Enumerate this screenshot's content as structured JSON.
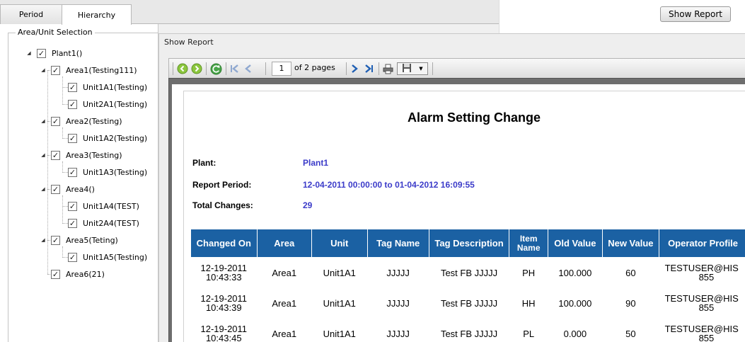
{
  "tabs": [
    {
      "label": "Period"
    },
    {
      "label": "Hierarchy"
    }
  ],
  "left": {
    "group_label": "Area/Unit Selection",
    "tree": [
      {
        "label": "Plant1()"
      },
      {
        "label": "Area1(Testing111)"
      },
      {
        "label": "Unit1A1(Testing)"
      },
      {
        "label": "Unit2A1(Testing)"
      },
      {
        "label": "Area2(Testing)"
      },
      {
        "label": "Unit1A2(Testing)"
      },
      {
        "label": "Area3(Testing)"
      },
      {
        "label": "Unit1A3(Testing)"
      },
      {
        "label": "Area4()"
      },
      {
        "label": "Unit1A4(TEST)"
      },
      {
        "label": "Unit2A4(TEST)"
      },
      {
        "label": "Area5(Teting)"
      },
      {
        "label": "Unit1A5(Testing)"
      },
      {
        "label": "Area6(21)"
      }
    ]
  },
  "right": {
    "show_report_label": "Show Report"
  },
  "window": {
    "title": "Show Report"
  },
  "toolbar": {
    "page_value": "1",
    "page_of": "of 2 pages"
  },
  "report": {
    "title": "Alarm Setting Change",
    "plant_label": "Plant:",
    "plant_value": "Plant1",
    "period_label": "Report Period:",
    "period_value": "12-04-2011 00:00:00 to 01-04-2012 16:09:55",
    "changes_label": "Total Changes:",
    "changes_value": "29",
    "columns": [
      "Changed On",
      "Area",
      "Unit",
      "Tag Name",
      "Tag Description",
      "Item Name",
      "Old Value",
      "New Value",
      "Operator Profile"
    ],
    "rows": [
      {
        "date": "12-19-2011",
        "time": "10:43:33",
        "area": "Area1",
        "unit": "Unit1A1",
        "tag": "JJJJJ",
        "desc": "Test FB JJJJJ",
        "item": "PH",
        "old": "100.000",
        "new": "60",
        "op1": "TESTUSER@HIS",
        "op2": "855"
      },
      {
        "date": "12-19-2011",
        "time": "10:43:39",
        "area": "Area1",
        "unit": "Unit1A1",
        "tag": "JJJJJ",
        "desc": "Test FB JJJJJ",
        "item": "HH",
        "old": "100.000",
        "new": "90",
        "op1": "TESTUSER@HIS",
        "op2": "855"
      },
      {
        "date": "12-19-2011",
        "time": "10:43:45",
        "area": "Area1",
        "unit": "Unit1A1",
        "tag": "JJJJJ",
        "desc": "Test FB JJJJJ",
        "item": "PL",
        "old": "0.000",
        "new": "50",
        "op1": "TESTUSER@HIS",
        "op2": "855"
      }
    ]
  },
  "colors": {
    "header_blue": "#1b61a3",
    "info_blue": "#3b3bc9"
  }
}
